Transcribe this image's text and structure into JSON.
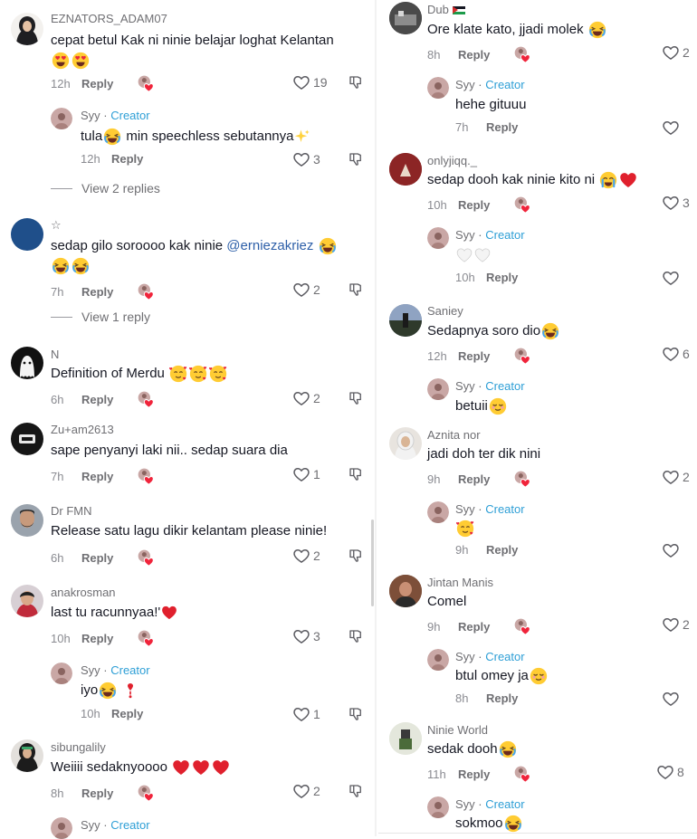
{
  "left": {
    "c1": {
      "user": "EZNATORS_ADAM07",
      "text1": "cepat betul Kak ni ninie belajar loghat Kelantan",
      "time": "12h",
      "reply": "Reply",
      "likes": "19",
      "avatar": "hijab-avatar"
    },
    "r1": {
      "user": "Syy",
      "badge": "Creator",
      "text": "tula",
      "text2": " min speechless sebutannya",
      "time": "12h",
      "reply": "Reply",
      "likes": "3"
    },
    "v1": "View 2 replies",
    "c2": {
      "user": "☆",
      "text1": "sedap gilo soroooo kak ninie ",
      "mention": "@erniezakriez",
      "time": "7h",
      "reply": "Reply",
      "likes": "2",
      "avatar": "blue-avatar"
    },
    "v2": "View 1 reply",
    "c3": {
      "user": "N",
      "text": "Definition of Merdu",
      "time": "6h",
      "reply": "Reply",
      "likes": "2"
    },
    "c4": {
      "user": "Zu+am2613",
      "text": "sape penyanyi laki nii.. sedap suara dia",
      "time": "7h",
      "reply": "Reply",
      "likes": "1"
    },
    "c5": {
      "user": "Dr FMN",
      "text": "Release satu lagu dikir kelantam please ninie!",
      "time": "6h",
      "reply": "Reply",
      "likes": "2"
    },
    "c6": {
      "user": "anakrosman",
      "text": "last tu racunnyaa!'",
      "time": "10h",
      "reply": "Reply",
      "likes": "3"
    },
    "r6": {
      "user": "Syy",
      "badge": "Creator",
      "text": "iyo",
      "time": "10h",
      "reply": "Reply",
      "likes": "1"
    },
    "c7": {
      "user": "sibungalily",
      "text": "Weiiii sedaknyoooo",
      "time": "8h",
      "reply": "Reply",
      "likes": "2"
    },
    "r7": {
      "user": "Syy",
      "badge": "Creator"
    }
  },
  "right": {
    "c1": {
      "user": "Dub",
      "text": "Ore klate kato, jjadi molek",
      "time": "8h",
      "reply": "Reply",
      "likes": "2"
    },
    "r1": {
      "user": "Syy",
      "badge": "Creator",
      "text": "hehe gituuu",
      "time": "7h",
      "reply": "Reply"
    },
    "c2": {
      "user": "onlyjiqq._",
      "text": "sedap dooh kak ninie kito ni",
      "time": "10h",
      "reply": "Reply",
      "likes": "3"
    },
    "r2": {
      "user": "Syy",
      "badge": "Creator",
      "time": "10h",
      "reply": "Reply"
    },
    "c3": {
      "user": "Saniey",
      "text": "Sedapnya soro dio",
      "time": "12h",
      "reply": "Reply",
      "likes": "6"
    },
    "r3": {
      "user": "Syy",
      "badge": "Creator",
      "text": "betuii"
    },
    "c4": {
      "user": "Aznita nor",
      "text": "jadi doh ter dik nini",
      "time": "9h",
      "reply": "Reply",
      "likes": "2"
    },
    "r4": {
      "user": "Syy",
      "badge": "Creator",
      "time": "9h",
      "reply": "Reply"
    },
    "c5": {
      "user": "Jintan Manis",
      "text": "Comel",
      "time": "9h",
      "reply": "Reply",
      "likes": "2"
    },
    "r5": {
      "user": "Syy",
      "badge": "Creator",
      "text": "btul omey ja",
      "time": "8h",
      "reply": "Reply"
    },
    "c6": {
      "user": "Ninie World",
      "text": "sedak dooh",
      "time": "11h",
      "reply": "Reply",
      "likes": "8"
    },
    "r6": {
      "user": "Syy",
      "badge": "Creator",
      "text": "sokmoo"
    }
  },
  "colors": {
    "creator": "#2e9fd6",
    "mention": "#2d5fa8",
    "heart": "#f0243b",
    "meta": "#8a8b91"
  }
}
